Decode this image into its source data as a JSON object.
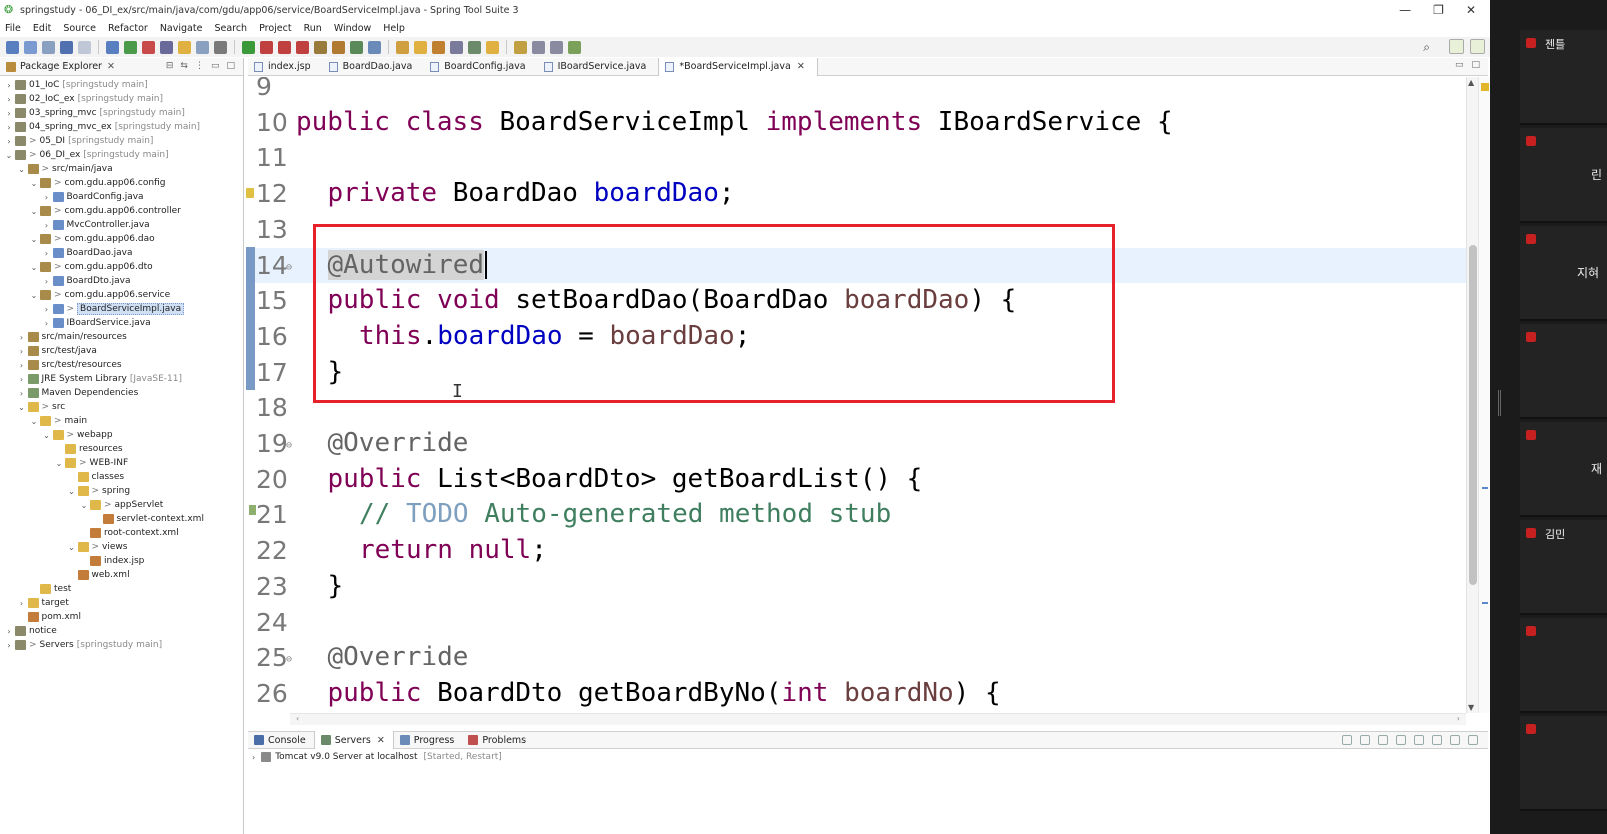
{
  "window": {
    "title": "springstudy - 06_DI_ex/src/main/java/com/gdu/app06/service/BoardServiceImpl.java - Spring Tool Suite 3",
    "controls": [
      "—",
      "❐",
      "✕"
    ]
  },
  "menu": [
    "File",
    "Edit",
    "Source",
    "Refactor",
    "Navigate",
    "Search",
    "Project",
    "Run",
    "Window",
    "Help"
  ],
  "explorer": {
    "title": "Package Explorer",
    "items": [
      {
        "indent": 0,
        "tw": "›",
        "icon": "proj",
        "gt": "",
        "label": "01_IoC",
        "extra": "[springstudy main]"
      },
      {
        "indent": 0,
        "tw": "›",
        "icon": "proj",
        "gt": "",
        "label": "02_IoC_ex",
        "extra": "[springstudy main]"
      },
      {
        "indent": 0,
        "tw": "›",
        "icon": "proj",
        "gt": "",
        "label": "03_spring_mvc",
        "extra": "[springstudy main]"
      },
      {
        "indent": 0,
        "tw": "›",
        "icon": "proj",
        "gt": "",
        "label": "04_spring_mvc_ex",
        "extra": "[springstudy main]"
      },
      {
        "indent": 0,
        "tw": "›",
        "icon": "proj",
        "gt": ">",
        "label": "05_DI",
        "extra": "[springstudy main]"
      },
      {
        "indent": 0,
        "tw": "⌄",
        "icon": "proj",
        "gt": ">",
        "label": "06_DI_ex",
        "extra": "[springstudy main]"
      },
      {
        "indent": 1,
        "tw": "⌄",
        "icon": "pkg",
        "gt": ">",
        "label": "src/main/java",
        "extra": ""
      },
      {
        "indent": 2,
        "tw": "⌄",
        "icon": "pkg",
        "gt": ">",
        "label": "com.gdu.app06.config",
        "extra": ""
      },
      {
        "indent": 3,
        "tw": "›",
        "icon": "java",
        "gt": "",
        "label": "BoardConfig.java",
        "extra": ""
      },
      {
        "indent": 2,
        "tw": "⌄",
        "icon": "pkg",
        "gt": ">",
        "label": "com.gdu.app06.controller",
        "extra": ""
      },
      {
        "indent": 3,
        "tw": "›",
        "icon": "java",
        "gt": "",
        "label": "MvcController.java",
        "extra": ""
      },
      {
        "indent": 2,
        "tw": "⌄",
        "icon": "pkg",
        "gt": ">",
        "label": "com.gdu.app06.dao",
        "extra": ""
      },
      {
        "indent": 3,
        "tw": "›",
        "icon": "java",
        "gt": "",
        "label": "BoardDao.java",
        "extra": ""
      },
      {
        "indent": 2,
        "tw": "⌄",
        "icon": "pkg",
        "gt": ">",
        "label": "com.gdu.app06.dto",
        "extra": ""
      },
      {
        "indent": 3,
        "tw": "›",
        "icon": "java",
        "gt": "",
        "label": "BoardDto.java",
        "extra": ""
      },
      {
        "indent": 2,
        "tw": "⌄",
        "icon": "pkg",
        "gt": ">",
        "label": "com.gdu.app06.service",
        "extra": ""
      },
      {
        "indent": 3,
        "tw": "›",
        "icon": "java",
        "gt": ">",
        "label": "BoardServiceImpl.java",
        "extra": "",
        "selected": true
      },
      {
        "indent": 3,
        "tw": "›",
        "icon": "java",
        "gt": "",
        "label": "IBoardService.java",
        "extra": ""
      },
      {
        "indent": 1,
        "tw": "›",
        "icon": "pkg",
        "gt": "",
        "label": "src/main/resources",
        "extra": ""
      },
      {
        "indent": 1,
        "tw": "›",
        "icon": "pkg",
        "gt": "",
        "label": "src/test/java",
        "extra": ""
      },
      {
        "indent": 1,
        "tw": "›",
        "icon": "pkg",
        "gt": "",
        "label": "src/test/resources",
        "extra": ""
      },
      {
        "indent": 1,
        "tw": "›",
        "icon": "lib",
        "gt": "",
        "label": "JRE System Library",
        "extra": "[JavaSE-11]"
      },
      {
        "indent": 1,
        "tw": "›",
        "icon": "lib",
        "gt": "",
        "label": "Maven Dependencies",
        "extra": ""
      },
      {
        "indent": 1,
        "tw": "⌄",
        "icon": "folder",
        "gt": ">",
        "label": "src",
        "extra": ""
      },
      {
        "indent": 2,
        "tw": "⌄",
        "icon": "folder",
        "gt": ">",
        "label": "main",
        "extra": ""
      },
      {
        "indent": 3,
        "tw": "⌄",
        "icon": "folder",
        "gt": ">",
        "label": "webapp",
        "extra": ""
      },
      {
        "indent": 4,
        "tw": "",
        "icon": "folder",
        "gt": "",
        "label": "resources",
        "extra": ""
      },
      {
        "indent": 4,
        "tw": "⌄",
        "icon": "folder",
        "gt": ">",
        "label": "WEB-INF",
        "extra": ""
      },
      {
        "indent": 5,
        "tw": "",
        "icon": "folder",
        "gt": "",
        "label": "classes",
        "extra": ""
      },
      {
        "indent": 5,
        "tw": "⌄",
        "icon": "folder",
        "gt": ">",
        "label": "spring",
        "extra": ""
      },
      {
        "indent": 6,
        "tw": "⌄",
        "icon": "folder",
        "gt": ">",
        "label": "appServlet",
        "extra": ""
      },
      {
        "indent": 7,
        "tw": "",
        "icon": "xml",
        "gt": "",
        "label": "servlet-context.xml",
        "extra": ""
      },
      {
        "indent": 6,
        "tw": "",
        "icon": "xml",
        "gt": "",
        "label": "root-context.xml",
        "extra": ""
      },
      {
        "indent": 5,
        "tw": "⌄",
        "icon": "folder",
        "gt": ">",
        "label": "views",
        "extra": ""
      },
      {
        "indent": 6,
        "tw": "",
        "icon": "xml",
        "gt": "",
        "label": "index.jsp",
        "extra": ""
      },
      {
        "indent": 5,
        "tw": "",
        "icon": "xml",
        "gt": "",
        "label": "web.xml",
        "extra": ""
      },
      {
        "indent": 2,
        "tw": "",
        "icon": "folder",
        "gt": "",
        "label": "test",
        "extra": ""
      },
      {
        "indent": 1,
        "tw": "›",
        "icon": "folder",
        "gt": "",
        "label": "target",
        "extra": ""
      },
      {
        "indent": 1,
        "tw": "",
        "icon": "xml",
        "gt": "",
        "label": "pom.xml",
        "extra": ""
      },
      {
        "indent": 0,
        "tw": "›",
        "icon": "proj",
        "gt": "",
        "label": "notice",
        "extra": ""
      },
      {
        "indent": 0,
        "tw": "›",
        "icon": "proj",
        "gt": ">",
        "label": "Servers",
        "extra": "[springstudy main]"
      }
    ]
  },
  "editor_tabs": [
    {
      "label": "index.jsp",
      "active": false,
      "closable": false
    },
    {
      "label": "BoardDao.java",
      "active": false,
      "closable": false
    },
    {
      "label": "BoardConfig.java",
      "active": false,
      "closable": false
    },
    {
      "label": "IBoardService.java",
      "active": false,
      "closable": false
    },
    {
      "label": "*BoardServiceImpl.java",
      "active": true,
      "closable": true
    }
  ],
  "code_lines": [
    {
      "n": "9",
      "fold": "",
      "segs": []
    },
    {
      "n": "10",
      "fold": "",
      "segs": [
        [
          "kw",
          "public "
        ],
        [
          "kw",
          "class "
        ],
        [
          "",
          "BoardServiceImpl "
        ],
        [
          "kw",
          "implements "
        ],
        [
          "",
          "IBoardService {"
        ]
      ],
      "indent": 0
    },
    {
      "n": "11",
      "fold": "",
      "segs": []
    },
    {
      "n": "12",
      "fold": "",
      "segs": [
        [
          "kw",
          "private "
        ],
        [
          "",
          "BoardDao "
        ],
        [
          "fld",
          "boardDao"
        ],
        [
          "",
          ";"
        ]
      ],
      "indent": 1
    },
    {
      "n": "13",
      "fold": "",
      "segs": []
    },
    {
      "n": "14",
      "fold": "⊖",
      "segs": [
        [
          "annhl",
          "@Autowired"
        ]
      ],
      "indent": 1,
      "current": true,
      "caret": true
    },
    {
      "n": "15",
      "fold": "",
      "segs": [
        [
          "kw",
          "public "
        ],
        [
          "kw",
          "void "
        ],
        [
          "",
          "setBoardDao(BoardDao "
        ],
        [
          "par",
          "boardDao"
        ],
        [
          "",
          ") {"
        ]
      ],
      "indent": 1
    },
    {
      "n": "16",
      "fold": "",
      "segs": [
        [
          "kw",
          "this"
        ],
        [
          "",
          "."
        ],
        [
          "fld",
          "boardDao"
        ],
        [
          "",
          " = "
        ],
        [
          "par",
          "boardDao"
        ],
        [
          "",
          ";"
        ]
      ],
      "indent": 2
    },
    {
      "n": "17",
      "fold": "",
      "segs": [
        [
          "",
          "}"
        ]
      ],
      "indent": 1
    },
    {
      "n": "18",
      "fold": "",
      "segs": []
    },
    {
      "n": "19",
      "fold": "⊖",
      "segs": [
        [
          "ann",
          "@Override"
        ]
      ],
      "indent": 1
    },
    {
      "n": "20",
      "fold": "",
      "segs": [
        [
          "kw",
          "public "
        ],
        [
          "",
          "List<BoardDto> getBoardList() {"
        ]
      ],
      "indent": 1
    },
    {
      "n": "21",
      "fold": "",
      "segs": [
        [
          "cmt",
          "// "
        ],
        [
          "todo",
          "TODO"
        ],
        [
          "cmt",
          " Auto-generated method stub"
        ]
      ],
      "indent": 2
    },
    {
      "n": "22",
      "fold": "",
      "segs": [
        [
          "kw",
          "return "
        ],
        [
          "kw",
          "null"
        ],
        [
          "",
          ";"
        ]
      ],
      "indent": 2
    },
    {
      "n": "23",
      "fold": "",
      "segs": [
        [
          "",
          "}"
        ]
      ],
      "indent": 1
    },
    {
      "n": "24",
      "fold": "",
      "segs": []
    },
    {
      "n": "25",
      "fold": "⊖",
      "segs": [
        [
          "ann",
          "@Override"
        ]
      ],
      "indent": 1
    },
    {
      "n": "26",
      "fold": "",
      "segs": [
        [
          "kw",
          "public "
        ],
        [
          "",
          "BoardDto getBoardByNo("
        ],
        [
          "kw",
          "int "
        ],
        [
          "par",
          "boardNo"
        ],
        [
          "",
          ") {"
        ]
      ],
      "indent": 1
    }
  ],
  "bottom_tabs": [
    {
      "label": "Console",
      "active": false,
      "closable": false,
      "color": "#4a6fa8"
    },
    {
      "label": "Servers",
      "active": true,
      "closable": true,
      "color": "#6a8a6a"
    },
    {
      "label": "Progress",
      "active": false,
      "closable": false,
      "color": "#6a8ab8"
    },
    {
      "label": "Problems",
      "active": false,
      "closable": false,
      "color": "#c05050"
    }
  ],
  "server": {
    "name": "Tomcat v9.0 Server at localhost",
    "status": "[Started, Restart]"
  },
  "participants": [
    {
      "name": "젠틀",
      "name2": ""
    },
    {
      "name": "",
      "name2": "린"
    },
    {
      "name": "",
      "name2": "지혀"
    },
    {
      "name": "",
      "name2": ""
    },
    {
      "name": "",
      "name2": "재"
    },
    {
      "name": "김민",
      "name2": ""
    },
    {
      "name": "",
      "name2": ""
    },
    {
      "name": "",
      "name2": ""
    }
  ],
  "colors": {
    "highlight_box": "#e8202a",
    "keyword": "#7f0055",
    "field": "#0000c0",
    "param": "#6a3e3e",
    "comment": "#3f7f5f"
  }
}
